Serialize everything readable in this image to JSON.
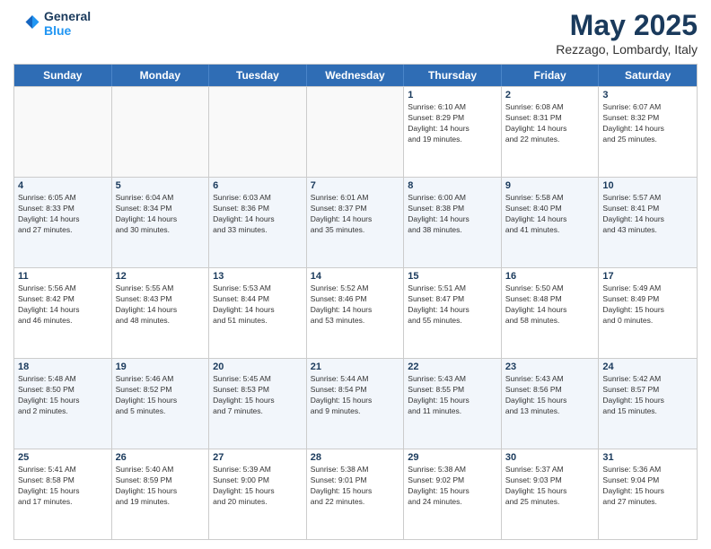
{
  "logo": {
    "line1": "General",
    "line2": "Blue"
  },
  "title": "May 2025",
  "subtitle": "Rezzago, Lombardy, Italy",
  "days": [
    "Sunday",
    "Monday",
    "Tuesday",
    "Wednesday",
    "Thursday",
    "Friday",
    "Saturday"
  ],
  "rows": [
    [
      {
        "day": "",
        "info": ""
      },
      {
        "day": "",
        "info": ""
      },
      {
        "day": "",
        "info": ""
      },
      {
        "day": "",
        "info": ""
      },
      {
        "day": "1",
        "info": "Sunrise: 6:10 AM\nSunset: 8:29 PM\nDaylight: 14 hours\nand 19 minutes."
      },
      {
        "day": "2",
        "info": "Sunrise: 6:08 AM\nSunset: 8:31 PM\nDaylight: 14 hours\nand 22 minutes."
      },
      {
        "day": "3",
        "info": "Sunrise: 6:07 AM\nSunset: 8:32 PM\nDaylight: 14 hours\nand 25 minutes."
      }
    ],
    [
      {
        "day": "4",
        "info": "Sunrise: 6:05 AM\nSunset: 8:33 PM\nDaylight: 14 hours\nand 27 minutes."
      },
      {
        "day": "5",
        "info": "Sunrise: 6:04 AM\nSunset: 8:34 PM\nDaylight: 14 hours\nand 30 minutes."
      },
      {
        "day": "6",
        "info": "Sunrise: 6:03 AM\nSunset: 8:36 PM\nDaylight: 14 hours\nand 33 minutes."
      },
      {
        "day": "7",
        "info": "Sunrise: 6:01 AM\nSunset: 8:37 PM\nDaylight: 14 hours\nand 35 minutes."
      },
      {
        "day": "8",
        "info": "Sunrise: 6:00 AM\nSunset: 8:38 PM\nDaylight: 14 hours\nand 38 minutes."
      },
      {
        "day": "9",
        "info": "Sunrise: 5:58 AM\nSunset: 8:40 PM\nDaylight: 14 hours\nand 41 minutes."
      },
      {
        "day": "10",
        "info": "Sunrise: 5:57 AM\nSunset: 8:41 PM\nDaylight: 14 hours\nand 43 minutes."
      }
    ],
    [
      {
        "day": "11",
        "info": "Sunrise: 5:56 AM\nSunset: 8:42 PM\nDaylight: 14 hours\nand 46 minutes."
      },
      {
        "day": "12",
        "info": "Sunrise: 5:55 AM\nSunset: 8:43 PM\nDaylight: 14 hours\nand 48 minutes."
      },
      {
        "day": "13",
        "info": "Sunrise: 5:53 AM\nSunset: 8:44 PM\nDaylight: 14 hours\nand 51 minutes."
      },
      {
        "day": "14",
        "info": "Sunrise: 5:52 AM\nSunset: 8:46 PM\nDaylight: 14 hours\nand 53 minutes."
      },
      {
        "day": "15",
        "info": "Sunrise: 5:51 AM\nSunset: 8:47 PM\nDaylight: 14 hours\nand 55 minutes."
      },
      {
        "day": "16",
        "info": "Sunrise: 5:50 AM\nSunset: 8:48 PM\nDaylight: 14 hours\nand 58 minutes."
      },
      {
        "day": "17",
        "info": "Sunrise: 5:49 AM\nSunset: 8:49 PM\nDaylight: 15 hours\nand 0 minutes."
      }
    ],
    [
      {
        "day": "18",
        "info": "Sunrise: 5:48 AM\nSunset: 8:50 PM\nDaylight: 15 hours\nand 2 minutes."
      },
      {
        "day": "19",
        "info": "Sunrise: 5:46 AM\nSunset: 8:52 PM\nDaylight: 15 hours\nand 5 minutes."
      },
      {
        "day": "20",
        "info": "Sunrise: 5:45 AM\nSunset: 8:53 PM\nDaylight: 15 hours\nand 7 minutes."
      },
      {
        "day": "21",
        "info": "Sunrise: 5:44 AM\nSunset: 8:54 PM\nDaylight: 15 hours\nand 9 minutes."
      },
      {
        "day": "22",
        "info": "Sunrise: 5:43 AM\nSunset: 8:55 PM\nDaylight: 15 hours\nand 11 minutes."
      },
      {
        "day": "23",
        "info": "Sunrise: 5:43 AM\nSunset: 8:56 PM\nDaylight: 15 hours\nand 13 minutes."
      },
      {
        "day": "24",
        "info": "Sunrise: 5:42 AM\nSunset: 8:57 PM\nDaylight: 15 hours\nand 15 minutes."
      }
    ],
    [
      {
        "day": "25",
        "info": "Sunrise: 5:41 AM\nSunset: 8:58 PM\nDaylight: 15 hours\nand 17 minutes."
      },
      {
        "day": "26",
        "info": "Sunrise: 5:40 AM\nSunset: 8:59 PM\nDaylight: 15 hours\nand 19 minutes."
      },
      {
        "day": "27",
        "info": "Sunrise: 5:39 AM\nSunset: 9:00 PM\nDaylight: 15 hours\nand 20 minutes."
      },
      {
        "day": "28",
        "info": "Sunrise: 5:38 AM\nSunset: 9:01 PM\nDaylight: 15 hours\nand 22 minutes."
      },
      {
        "day": "29",
        "info": "Sunrise: 5:38 AM\nSunset: 9:02 PM\nDaylight: 15 hours\nand 24 minutes."
      },
      {
        "day": "30",
        "info": "Sunrise: 5:37 AM\nSunset: 9:03 PM\nDaylight: 15 hours\nand 25 minutes."
      },
      {
        "day": "31",
        "info": "Sunrise: 5:36 AM\nSunset: 9:04 PM\nDaylight: 15 hours\nand 27 minutes."
      }
    ]
  ]
}
